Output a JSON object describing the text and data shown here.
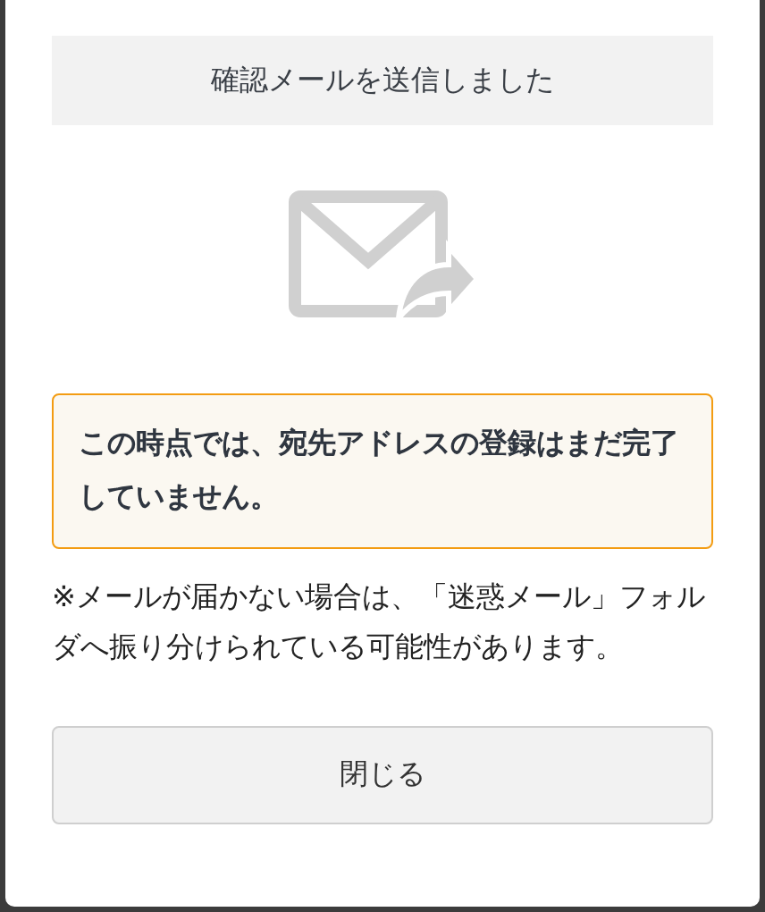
{
  "dialog": {
    "title": "確認メールを送信しました",
    "notice": "この時点では、宛先アドレスの登録はまだ完了していません。",
    "message": "※メールが届かない場合は、「迷惑メール」フォルダへ振り分けられている可能性があります。",
    "buttons": [
      {
        "label": "閉じる"
      }
    ]
  }
}
